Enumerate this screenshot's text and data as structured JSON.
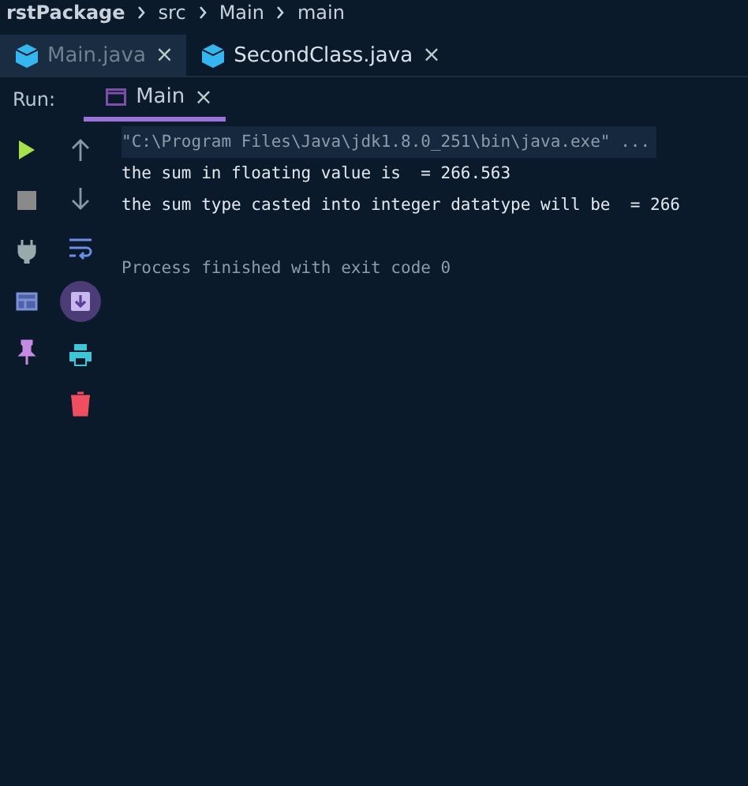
{
  "breadcrumbs": [
    "rstPackage",
    "src",
    "Main",
    "main"
  ],
  "editor_tabs": [
    {
      "label": "Main.java",
      "selected": true,
      "close": "×"
    },
    {
      "label": "SecondClass.java",
      "selected": false,
      "close": "×"
    }
  ],
  "run_panel": {
    "label": "Run:",
    "tabs": [
      {
        "label": "Main",
        "selected": true,
        "close": "×"
      }
    ]
  },
  "left_tools": [
    {
      "kind": "play"
    },
    {
      "kind": "stop"
    },
    {
      "kind": "plug"
    },
    {
      "kind": "layout"
    },
    {
      "kind": "pin"
    }
  ],
  "right_tools": [
    {
      "kind": "up",
      "selected": false
    },
    {
      "kind": "down",
      "selected": false
    },
    {
      "kind": "wrap",
      "selected": false
    },
    {
      "kind": "scroll",
      "selected": true
    },
    {
      "kind": "print",
      "selected": false
    },
    {
      "kind": "trash",
      "selected": false
    }
  ],
  "console": [
    {
      "kind": "command",
      "text": "\"C:\\Program Files\\Java\\jdk1.8.0_251\\bin\\java.exe\" ..."
    },
    {
      "kind": "output",
      "text": "the sum in floating value is  = 266.563"
    },
    {
      "kind": "output",
      "text": "the sum type casted into integer datatype will be  = 266"
    },
    {
      "kind": "blank"
    },
    {
      "kind": "status",
      "text": "Process finished with exit code 0"
    }
  ]
}
